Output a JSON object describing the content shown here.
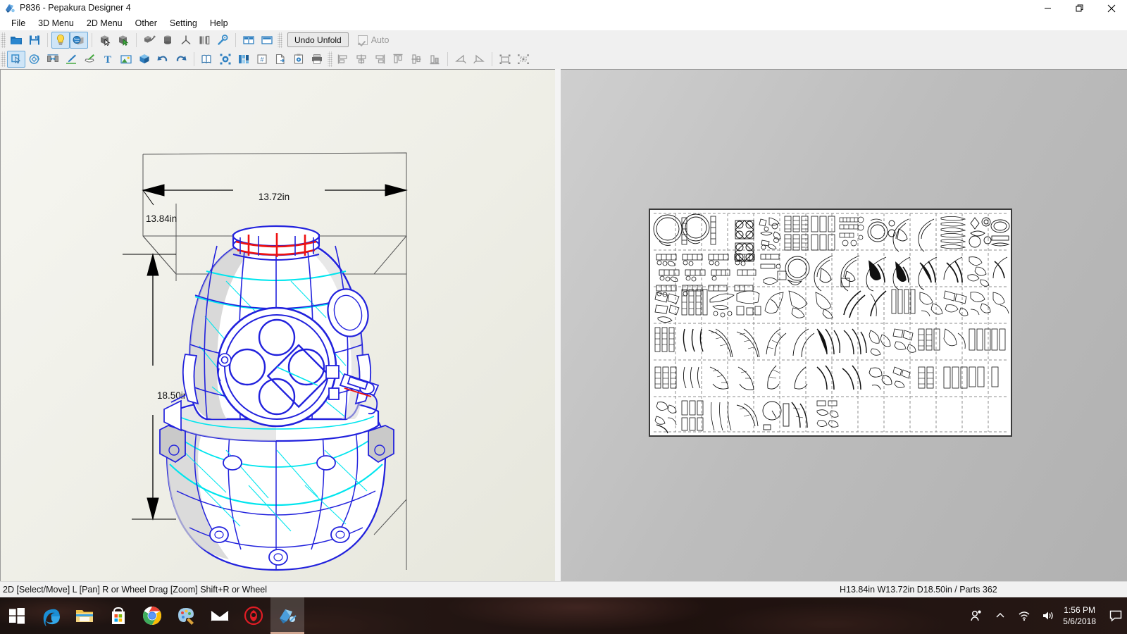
{
  "window": {
    "title": "P836 - Pepakura Designer 4",
    "app_icon": "pepakura-icon",
    "controls": [
      {
        "name": "minimize",
        "glyph": "—"
      },
      {
        "name": "restore",
        "glyph": "❐"
      },
      {
        "name": "close",
        "glyph": "✕"
      }
    ]
  },
  "menubar": {
    "items": [
      {
        "label": "File"
      },
      {
        "label": "3D Menu"
      },
      {
        "label": "2D Menu"
      },
      {
        "label": "Other"
      },
      {
        "label": "Setting"
      },
      {
        "label": "Help"
      }
    ]
  },
  "toolbar_row1": {
    "groups": [
      {
        "buttons": [
          {
            "name": "open-file-icon",
            "active": false
          },
          {
            "name": "save-file-icon",
            "active": false
          }
        ]
      },
      {
        "buttons": [
          {
            "name": "lighting-bulb-icon",
            "active": true
          },
          {
            "name": "texture-model-icon",
            "active": true
          }
        ]
      },
      {
        "buttons": [
          {
            "name": "select-face-icon",
            "active": false
          },
          {
            "name": "select-part-icon",
            "active": false
          }
        ]
      },
      {
        "buttons": [
          {
            "name": "paint-model-icon",
            "active": false
          },
          {
            "name": "cylinder-primitive-icon",
            "active": false
          },
          {
            "name": "axis-tripod-icon",
            "active": false
          },
          {
            "name": "flip-faces-icon",
            "active": false
          },
          {
            "name": "joint-edges-icon",
            "active": false
          }
        ]
      },
      {
        "buttons": [
          {
            "name": "split-view-vertical-icon",
            "active": false
          },
          {
            "name": "single-view-icon",
            "active": false
          }
        ]
      }
    ],
    "undo_unfold_label": "Undo Unfold",
    "auto_label": "Auto",
    "auto_checked": true,
    "auto_enabled": false
  },
  "toolbar_row2": {
    "groups": [
      {
        "buttons": [
          {
            "name": "select-move-2d-icon",
            "active": true,
            "disabled": false
          },
          {
            "name": "rotate-part-icon",
            "active": false,
            "disabled": false
          },
          {
            "name": "join-disjoin-icon",
            "active": false,
            "disabled": false
          },
          {
            "name": "edit-flap-icon",
            "active": false,
            "disabled": false
          },
          {
            "name": "divide-face-icon",
            "active": false,
            "disabled": false
          },
          {
            "name": "add-text-icon",
            "active": false,
            "disabled": false
          },
          {
            "name": "add-image-icon",
            "active": false,
            "disabled": false
          },
          {
            "name": "unfold-3d-icon",
            "active": false,
            "disabled": false
          },
          {
            "name": "undo-icon",
            "active": false,
            "disabled": false
          },
          {
            "name": "redo-icon",
            "active": false,
            "disabled": false
          }
        ]
      },
      {
        "buttons": [
          {
            "name": "page-layout-icon",
            "active": false,
            "disabled": false
          },
          {
            "name": "fit-page-icon",
            "active": false,
            "disabled": false
          },
          {
            "name": "arrange-parts-icon",
            "active": false,
            "disabled": false
          },
          {
            "name": "number-parts-icon",
            "active": false,
            "disabled": false
          },
          {
            "name": "export-icon",
            "active": false,
            "disabled": false
          },
          {
            "name": "clipboard-copy-icon",
            "active": false,
            "disabled": false
          },
          {
            "name": "print-icon",
            "active": false,
            "disabled": false
          }
        ]
      },
      {
        "buttons": [
          {
            "name": "align-left-icon",
            "active": false,
            "disabled": true
          },
          {
            "name": "align-center-horizontal-icon",
            "active": false,
            "disabled": true
          },
          {
            "name": "align-right-icon",
            "active": false,
            "disabled": true
          },
          {
            "name": "align-top-icon",
            "active": false,
            "disabled": true
          },
          {
            "name": "align-middle-vertical-icon",
            "active": false,
            "disabled": true
          },
          {
            "name": "align-bottom-icon",
            "active": false,
            "disabled": true
          }
        ]
      },
      {
        "buttons": [
          {
            "name": "rotate-left-icon",
            "active": false,
            "disabled": true
          },
          {
            "name": "rotate-right-icon",
            "active": false,
            "disabled": true
          }
        ]
      },
      {
        "buttons": [
          {
            "name": "select-all-parts-icon",
            "active": false,
            "disabled": true
          },
          {
            "name": "scatter-parts-icon",
            "active": false,
            "disabled": true
          }
        ]
      }
    ]
  },
  "view3d": {
    "model_name": "diving-helmet-model",
    "dimensions": {
      "width_label": "13.72in",
      "depth_label": "13.84in",
      "height_label": "18.50in"
    },
    "colors": {
      "edge_blue": "#2222dd",
      "fold_cyan": "#00e5ee",
      "cut_red": "#ee1111",
      "bbox_grey": "#555555",
      "background": "#f1f1ea"
    }
  },
  "view2d": {
    "page_name": "unfold-pattern-page",
    "grid_columns": 14,
    "grid_rows": 6,
    "page_background": "#ffffff",
    "guide_color": "#9a9a9a",
    "pane_background": "#bfbfbf"
  },
  "statusbar": {
    "hint": "2D [Select/Move] L [Pan] R or Wheel Drag [Zoom] Shift+R or Wheel",
    "info": "H13.84in W13.72in D18.50in / Parts 362"
  },
  "taskbar": {
    "items": [
      {
        "name": "start-button",
        "label": "Start"
      },
      {
        "name": "taskbar-edge",
        "label": "Microsoft Edge"
      },
      {
        "name": "taskbar-file-explorer",
        "label": "File Explorer"
      },
      {
        "name": "taskbar-store",
        "label": "Microsoft Store"
      },
      {
        "name": "taskbar-chrome",
        "label": "Google Chrome"
      },
      {
        "name": "taskbar-paint3d",
        "label": "Paint 3D"
      },
      {
        "name": "taskbar-mail",
        "label": "Mail"
      },
      {
        "name": "taskbar-red-app",
        "label": "App"
      },
      {
        "name": "taskbar-pepakura",
        "label": "Pepakura Designer 4",
        "active": true
      }
    ],
    "tray": [
      {
        "name": "people-icon"
      },
      {
        "name": "show-hidden-icons-chevron"
      },
      {
        "name": "network-wifi-icon"
      },
      {
        "name": "volume-speaker-icon"
      }
    ],
    "clock": {
      "time": "1:56 PM",
      "date": "5/6/2018"
    },
    "action_center_icon": "action-center-icon"
  }
}
